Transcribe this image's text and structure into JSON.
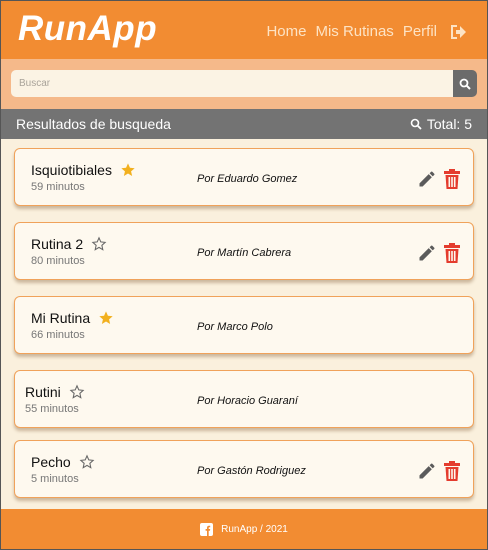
{
  "header": {
    "brand": "RunApp",
    "nav": [
      "Home",
      "Mis Rutinas",
      "Perfil"
    ]
  },
  "search": {
    "placeholder": "Buscar"
  },
  "results": {
    "title": "Resultados de busqueda",
    "total": "Total: 5"
  },
  "routines": [
    {
      "name": "Isquiotibiales",
      "duration": "59 minutos",
      "author": "Por Eduardo Gomez",
      "favorite": true,
      "editable": true
    },
    {
      "name": "Rutina 2",
      "duration": "80 minutos",
      "author": "Por Martín Cabrera",
      "favorite": false,
      "editable": true
    },
    {
      "name": "Mi Rutina",
      "duration": "66 minutos",
      "author": "Por Marco Polo",
      "favorite": true,
      "editable": false
    },
    {
      "name": "Rutini",
      "duration": "55 minutos",
      "author": "Por Horacio Guaraní",
      "favorite": false,
      "editable": false
    },
    {
      "name": "Pecho",
      "duration": "5 minutos",
      "author": "Por Gastón Rodriguez",
      "favorite": false,
      "editable": true
    }
  ],
  "footer": {
    "text": "RunApp / 2021"
  },
  "colors": {
    "primary": "#f28c32",
    "star": "#f2b01e",
    "delete": "#e43c2e",
    "edit": "#5b5b5b"
  }
}
